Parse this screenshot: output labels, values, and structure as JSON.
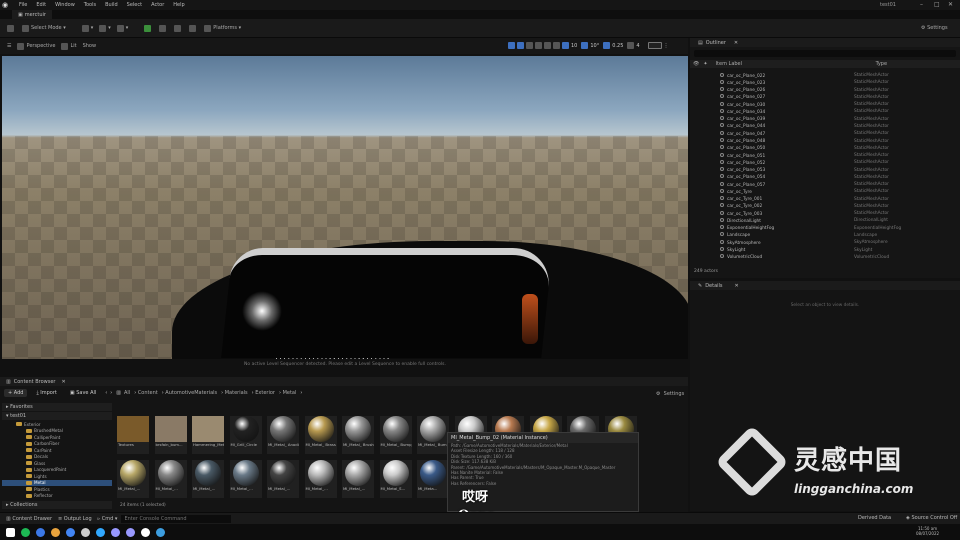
{
  "menu": {
    "items": [
      "File",
      "Edit",
      "Window",
      "Tools",
      "Build",
      "Select",
      "Actor",
      "Help"
    ],
    "project": "test01"
  },
  "level_tab": "merctuir",
  "toolbar": {
    "select_mode": "Select Mode",
    "platforms": "Platforms",
    "settings": "Settings"
  },
  "viewport": {
    "perspective": "Perspective",
    "lit": "Lit",
    "show": "Show",
    "snap_values": [
      "10",
      "10°",
      "0.25",
      "4"
    ],
    "message": "No active Level Sequencer detected. Please edit a Level Sequence to enable full controls."
  },
  "outliner": {
    "title": "Outliner",
    "col_label": "Item Label",
    "col_type": "Type",
    "rows": [
      {
        "label": "car_oc_Plane_022",
        "type": "StaticMeshActor"
      },
      {
        "label": "car_oc_Plane_023",
        "type": "StaticMeshActor"
      },
      {
        "label": "car_oc_Plane_026",
        "type": "StaticMeshActor"
      },
      {
        "label": "car_oc_Plane_027",
        "type": "StaticMeshActor"
      },
      {
        "label": "car_oc_Plane_030",
        "type": "StaticMeshActor"
      },
      {
        "label": "car_oc_Plane_034",
        "type": "StaticMeshActor"
      },
      {
        "label": "car_oc_Plane_039",
        "type": "StaticMeshActor"
      },
      {
        "label": "car_oc_Plane_044",
        "type": "StaticMeshActor"
      },
      {
        "label": "car_oc_Plane_047",
        "type": "StaticMeshActor"
      },
      {
        "label": "car_oc_Plane_048",
        "type": "StaticMeshActor"
      },
      {
        "label": "car_oc_Plane_050",
        "type": "StaticMeshActor"
      },
      {
        "label": "car_oc_Plane_051",
        "type": "StaticMeshActor"
      },
      {
        "label": "car_oc_Plane_052",
        "type": "StaticMeshActor"
      },
      {
        "label": "car_oc_Plane_053",
        "type": "StaticMeshActor"
      },
      {
        "label": "car_oc_Plane_054",
        "type": "StaticMeshActor"
      },
      {
        "label": "car_oc_Plane_057",
        "type": "StaticMeshActor"
      },
      {
        "label": "car_oc_Tyre",
        "type": "StaticMeshActor"
      },
      {
        "label": "car_oc_Tyre_001",
        "type": "StaticMeshActor"
      },
      {
        "label": "car_oc_Tyre_002",
        "type": "StaticMeshActor"
      },
      {
        "label": "car_oc_Tyre_003",
        "type": "StaticMeshActor"
      },
      {
        "label": "DirectionalLight",
        "type": "DirectionalLight"
      },
      {
        "label": "ExponentialHeightFog",
        "type": "ExponentialHeightFog"
      },
      {
        "label": "Landscape",
        "type": "Landscape"
      },
      {
        "label": "SkyAtmosphere",
        "type": "SkyAtmosphere"
      },
      {
        "label": "SkyLight",
        "type": "SkyLight"
      },
      {
        "label": "VolumetricCloud",
        "type": "VolumetricCloud"
      }
    ],
    "count": "249 actors"
  },
  "details": {
    "title": "Details",
    "empty_message": "Select an object to view details."
  },
  "content_browser": {
    "title": "Content Browser",
    "add": "+ Add",
    "import": "Import",
    "save_all": "Save All",
    "breadcrumb": [
      "All",
      "Content",
      "AutomotiveMaterials",
      "Materials",
      "Exterior",
      "Metal"
    ],
    "settings": "Settings",
    "favorites": "Favorites",
    "project": "test01",
    "collections": "Collections",
    "tree": [
      {
        "label": "Exterior",
        "selected": false
      },
      {
        "label": "BrushedMetal",
        "selected": false
      },
      {
        "label": "CalliperPaint",
        "selected": false
      },
      {
        "label": "CarbonFiber",
        "selected": false
      },
      {
        "label": "CarPaint",
        "selected": false
      },
      {
        "label": "Decals",
        "selected": false
      },
      {
        "label": "Glass",
        "selected": false
      },
      {
        "label": "LacqueredPaint",
        "selected": false
      },
      {
        "label": "Lights",
        "selected": false
      },
      {
        "label": "Metal",
        "selected": true
      },
      {
        "label": "Plastics",
        "selected": false
      },
      {
        "label": "Reflector",
        "selected": false
      }
    ],
    "row1": [
      {
        "label": "Textures",
        "color": "#7a5a2a"
      },
      {
        "label": "brsfaln_bum...",
        "color": "#8a7a66"
      },
      {
        "label": "Hammering_Metallic...",
        "color": "#9a8a70"
      },
      {
        "label": "MI_Grill_Circle",
        "color": "#222222"
      },
      {
        "label": "MI_Metal_ Anodized_01",
        "color": "#777777"
      },
      {
        "label": "MI_Metal_ Brass",
        "color": "#b89a50"
      },
      {
        "label": "MI_Metal_ Brushed",
        "color": "#999999"
      },
      {
        "label": "MI_Metal_ Bump_01",
        "color": "#888888"
      },
      {
        "label": "MI_Metal_ Bump_02",
        "color": "#aaaaaa"
      },
      {
        "label": "MI_Metal_ Chrome",
        "color": "#cccccc"
      },
      {
        "label": "MI_Metal_ Copper",
        "color": "#b87a50"
      },
      {
        "label": "MI_Metal_ Gold",
        "color": "#c8a848"
      },
      {
        "label": "MI_Metal_ Iron",
        "color": "#6a6a6a"
      },
      {
        "label": "MI_Metal_ Gold_Dirty",
        "color": "#9a8a40"
      }
    ],
    "row2": [
      {
        "label": "MI_Metal_...",
        "color": "#b8a868"
      },
      {
        "label": "MI_Metal_...",
        "color": "#888888"
      },
      {
        "label": "MI_Metal_...",
        "color": "#4a5a66"
      },
      {
        "label": "MI_Metal_...",
        "color": "#6a7a88"
      },
      {
        "label": "MI_Metal_...",
        "color": "#444444"
      },
      {
        "label": "MI_Metal_...",
        "color": "#bbbbbb"
      },
      {
        "label": "MI_Metal_...",
        "color": "#aaaaaa"
      },
      {
        "label": "MI_Metal_S...",
        "color": "#cccccc"
      },
      {
        "label": "MI_Meta...",
        "color": "#3a5a88"
      }
    ],
    "status": "24 items (1 selected)"
  },
  "tooltip": {
    "title": "MI_Metal_Bump_02 (Material Instance)",
    "lines": [
      "Path: /Game/AutomotiveMaterials/Materials/Exterior/Metal",
      "Asset Filesize Length: 118 / 128",
      "Disk Texture Length: 160 / 360",
      "Disk Size: 117.638 KiB",
      "Parent: /Game/AutomotiveMaterials/Masters/M_Opaque_Master.M_Opaque_Master",
      "Has Nanite Material: False",
      "Has Parent: True",
      "Has Referencers: False"
    ]
  },
  "subtitle": {
    "chinese": "哎呀",
    "english": "Oops,"
  },
  "bottombar": {
    "content_drawer": "Content Drawer",
    "output_log": "Output Log",
    "cmd": "Cmd",
    "cmd_placeholder": "Enter Console Command",
    "derived_data": "Derived Data",
    "source_control": "Source Control Off"
  },
  "taskbar": {
    "time": "11:50 am",
    "date": "08/07/2022",
    "app_colors": [
      "#ffffff",
      "#1db954",
      "#3b78e7",
      "#e8a33d",
      "#4285f4",
      "#cccccc",
      "#31a8ff",
      "#9999ff",
      "#9999ff",
      "#ffffff",
      "#3d9ee0"
    ]
  },
  "watermark": {
    "chinese": "灵感中国",
    "english": "lingganchina.com"
  }
}
